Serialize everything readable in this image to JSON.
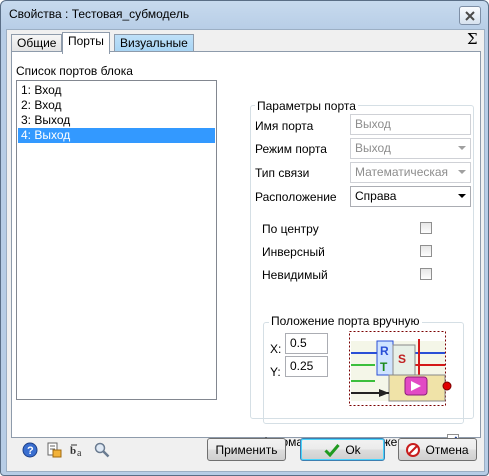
{
  "window": {
    "title": "Свойства :  Тестовая_субмодель"
  },
  "tabs": [
    {
      "label": "Общие"
    },
    {
      "label": "Порты"
    },
    {
      "label": "Визуальные слои"
    }
  ],
  "sigma": "Σ",
  "ports_list": {
    "label": "Список портов блока",
    "items": [
      "1: Вход",
      "2: Вход",
      "3: Выход",
      "4: Выход"
    ],
    "selected_index": 3
  },
  "port_params": {
    "group_label": "Параметры порта",
    "name_label": "Имя порта",
    "name_value": "Выход",
    "mode_label": "Режим порта",
    "mode_value": "Выход",
    "link_label": "Тип связи",
    "link_value": "Математическая",
    "placement_label": "Расположение",
    "placement_value": "Справа",
    "center_label": "По центру",
    "center_checked": false,
    "inverse_label": "Инверсный",
    "inverse_checked": false,
    "invisible_label": "Невидимый",
    "invisible_checked": false
  },
  "manual_pos": {
    "group_label": "Положение порта вручную",
    "x_label": "X:",
    "x_value": "0.5",
    "y_label": "Y:",
    "y_value": "0.25"
  },
  "auto_pos": {
    "label": "Автоматическое положение",
    "checked": true
  },
  "buttons": {
    "apply": "Применить",
    "ok": "Ok",
    "cancel": "Отмена"
  },
  "icons": [
    "help-icon",
    "properties-icon",
    "rename-icon",
    "search-icon"
  ],
  "colors": {
    "selection": "#3399ff",
    "tab_blue": "#a7d4f4"
  }
}
